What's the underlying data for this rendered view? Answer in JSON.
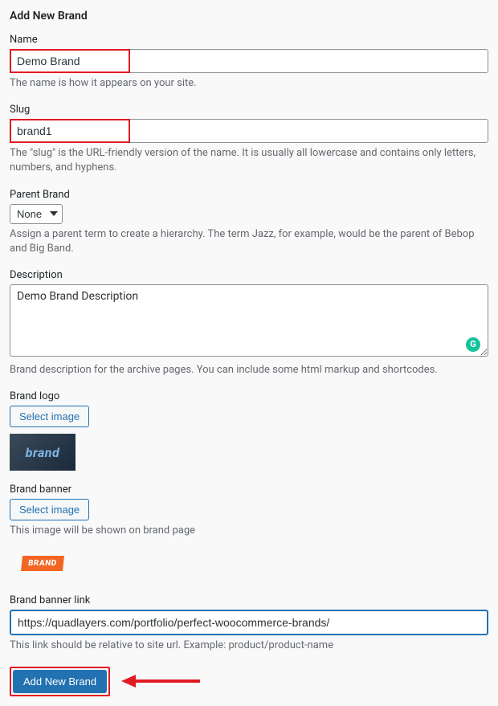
{
  "form": {
    "title": "Add New Brand",
    "name": {
      "label": "Name",
      "value": "Demo Brand",
      "help": "The name is how it appears on your site."
    },
    "slug": {
      "label": "Slug",
      "value": "brand1",
      "help": "The \"slug\" is the URL-friendly version of the name. It is usually all lowercase and contains only letters, numbers, and hyphens."
    },
    "parent": {
      "label": "Parent Brand",
      "selected": "None",
      "help": "Assign a parent term to create a hierarchy. The term Jazz, for example, would be the parent of Bebop and Big Band."
    },
    "description": {
      "label": "Description",
      "value": "Demo Brand Description",
      "help": "Brand description for the archive pages. You can include some html markup and shortcodes."
    },
    "logo": {
      "label": "Brand logo",
      "button": "Select image",
      "preview_text": "brand"
    },
    "banner": {
      "label": "Brand banner",
      "button": "Select image",
      "help": "This image will be shown on brand page",
      "preview_text": "BRAND"
    },
    "banner_link": {
      "label": "Brand banner link",
      "value": "https://quadlayers.com/portfolio/perfect-woocommerce-brands/",
      "help": "This link should be relative to site url. Example: product/product-name"
    },
    "submit_button": "Add New Brand"
  }
}
